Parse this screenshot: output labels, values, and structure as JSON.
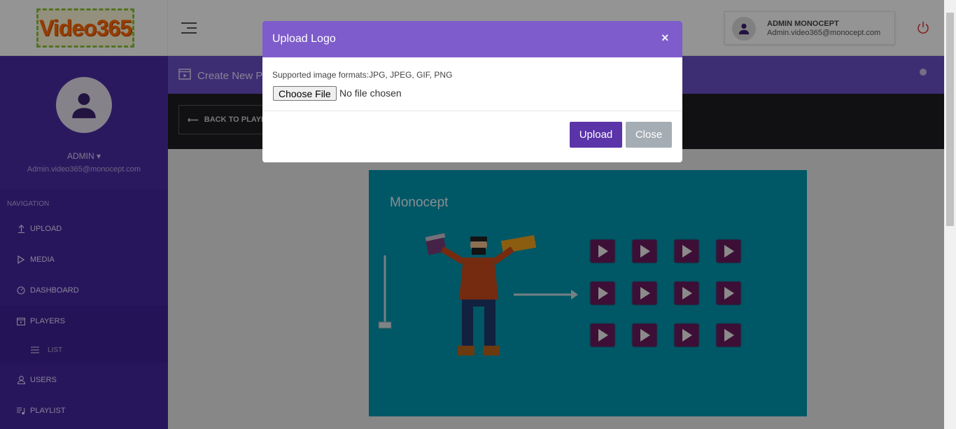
{
  "header": {
    "logo_text": "Video365",
    "user_name": "ADMIN MONOCEPT",
    "user_email": "Admin.video365@monocept.com"
  },
  "sidebar": {
    "profile_name": "ADMIN",
    "profile_email": "Admin.video365@monocept.com",
    "nav_title": "NAVIGATION",
    "items": [
      {
        "label": "UPLOAD",
        "icon": "upload-icon"
      },
      {
        "label": "MEDIA",
        "icon": "play-icon"
      },
      {
        "label": "DASHBOARD",
        "icon": "gauge-icon"
      },
      {
        "label": "PLAYERS",
        "icon": "player-icon"
      },
      {
        "label": "LIST",
        "icon": "list-icon"
      },
      {
        "label": "USERS",
        "icon": "user-icon"
      },
      {
        "label": "PLAYLIST",
        "icon": "playlist-icon"
      }
    ]
  },
  "page": {
    "title": "Create New Pl",
    "back_label": "BACK TO PLAYE",
    "preview_title": "Monocept"
  },
  "modal": {
    "title": "Upload Logo",
    "close_symbol": "×",
    "formats_text": "Supported image formats:JPG, JPEG, GIF, PNG",
    "choose_file_label": "Choose File",
    "no_file_text": "No file chosen",
    "upload_label": "Upload",
    "close_label": "Close"
  },
  "colors": {
    "sidebar": "#4527a0",
    "modal_header": "#7e5ccb",
    "upload_button": "#5a34a8",
    "close_button": "#a4acb4",
    "preview_bg": "#0096b0"
  }
}
